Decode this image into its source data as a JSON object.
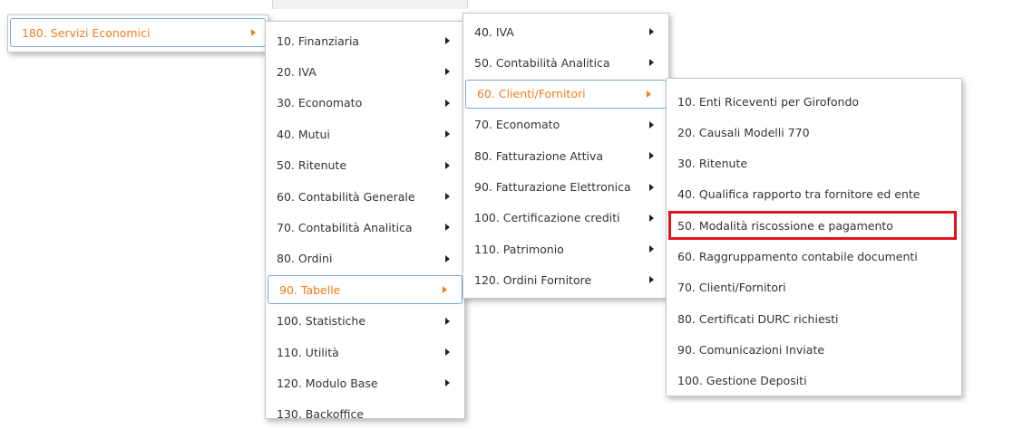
{
  "root": {
    "label": "180. Servizi Economici"
  },
  "level1": [
    {
      "label": "10. Finanziaria",
      "arrow": true
    },
    {
      "label": "20. IVA",
      "arrow": true
    },
    {
      "label": "30. Economato",
      "arrow": true
    },
    {
      "label": "40. Mutui",
      "arrow": true
    },
    {
      "label": "50. Ritenute",
      "arrow": true
    },
    {
      "label": "60. Contabilità Generale",
      "arrow": true
    },
    {
      "label": "70. Contabilità Analitica",
      "arrow": true
    },
    {
      "label": "80. Ordini",
      "arrow": true
    },
    {
      "label": "90. Tabelle",
      "arrow": true,
      "active": true
    },
    {
      "label": "100. Statistiche",
      "arrow": true
    },
    {
      "label": "110. Utilità",
      "arrow": true
    },
    {
      "label": "120. Modulo Base",
      "arrow": true
    },
    {
      "label": "130. Backoffice",
      "arrow": false
    }
  ],
  "level2": [
    {
      "label": "40. IVA",
      "arrow": true
    },
    {
      "label": "50. Contabilità Analitica",
      "arrow": true
    },
    {
      "label": "60. Clienti/Fornitori",
      "arrow": true,
      "active": true
    },
    {
      "label": "70. Economato",
      "arrow": true
    },
    {
      "label": "80. Fatturazione Attiva",
      "arrow": true
    },
    {
      "label": "90. Fatturazione Elettronica",
      "arrow": true
    },
    {
      "label": "100. Certificazione crediti",
      "arrow": true
    },
    {
      "label": "110. Patrimonio",
      "arrow": true
    },
    {
      "label": "120. Ordini Fornitore",
      "arrow": true
    }
  ],
  "level3": [
    {
      "label": "10. Enti Riceventi per Girofondo"
    },
    {
      "label": "20. Causali Modelli 770"
    },
    {
      "label": "30. Ritenute"
    },
    {
      "label": "40. Qualifica rapporto tra fornitore ed ente"
    },
    {
      "label": "50. Modalità riscossione e pagamento",
      "highlighted": true
    },
    {
      "label": "60. Raggruppamento contabile documenti"
    },
    {
      "label": "70. Clienti/Fornitori"
    },
    {
      "label": "80. Certificati DURC richiesti"
    },
    {
      "label": "90. Comunicazioni Inviate"
    },
    {
      "label": "100. Gestione Depositi"
    }
  ],
  "colors": {
    "accent": "#ef7d1a",
    "active_border": "#7aa7d9",
    "highlight": "#e1141c"
  }
}
